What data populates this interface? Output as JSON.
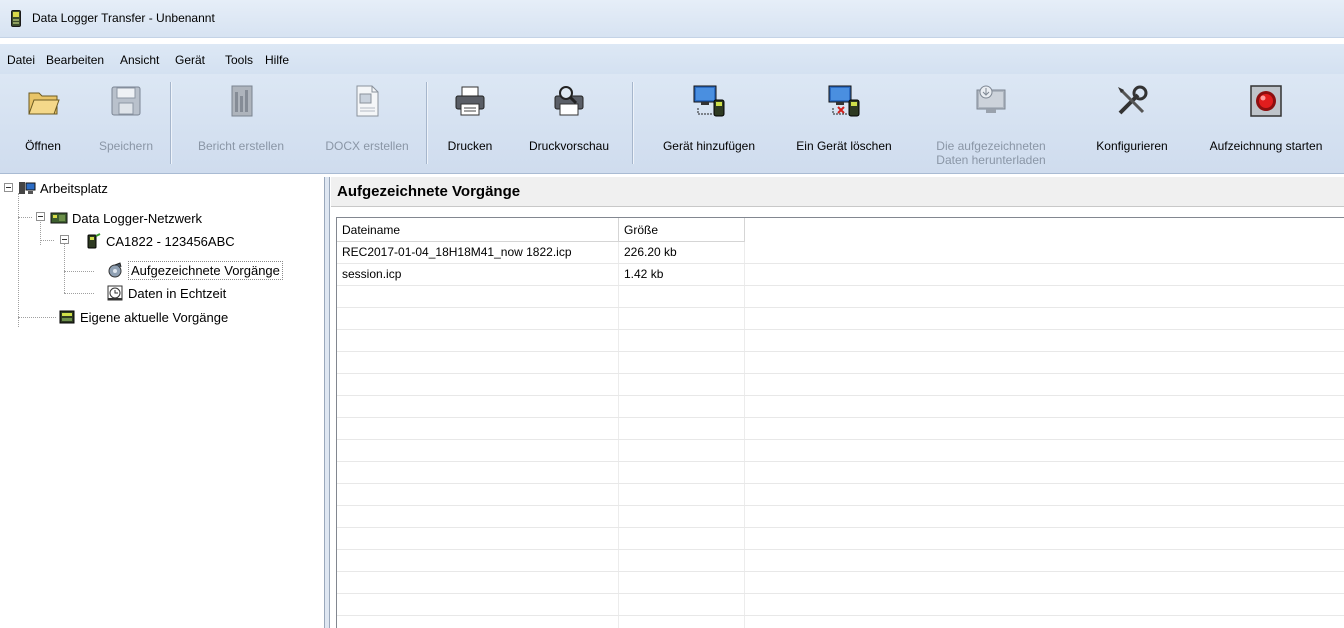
{
  "window": {
    "title": "Data Logger Transfer - Unbenannt",
    "app_icon": "data-logger-icon"
  },
  "menu": [
    "Datei",
    "Bearbeiten",
    "Ansicht",
    "Gerät",
    "Tools",
    "Hilfe"
  ],
  "toolbar": {
    "open": "Öffnen",
    "save": "Speichern",
    "report": "Bericht erstellen",
    "docx": "DOCX erstellen",
    "print": "Drucken",
    "preview": "Druckvorschau",
    "add_device": "Gerät hinzufügen",
    "delete_device": "Ein Gerät löschen",
    "download_line1": "Die aufgezeichneten",
    "download_line2": "Daten herunterladen",
    "configure": "Konfigurieren",
    "start_recording": "Aufzeichnung starten"
  },
  "tree": {
    "root": "Arbeitsplatz",
    "network": "Data Logger-Netzwerk",
    "device": "CA1822 - 123456ABC",
    "recorded": "Aufgezeichnete Vorgänge",
    "realtime": "Daten in Echtzeit",
    "own": "Eigene aktuelle Vorgänge"
  },
  "content": {
    "title": "Aufgezeichnete Vorgänge",
    "columns": [
      "Dateiname",
      "Größe"
    ],
    "rows": [
      [
        "REC2017-01-04_18H18M41_now 1822.icp",
        "226.20 kb"
      ],
      [
        "session.icp",
        "1.42 kb"
      ]
    ]
  }
}
